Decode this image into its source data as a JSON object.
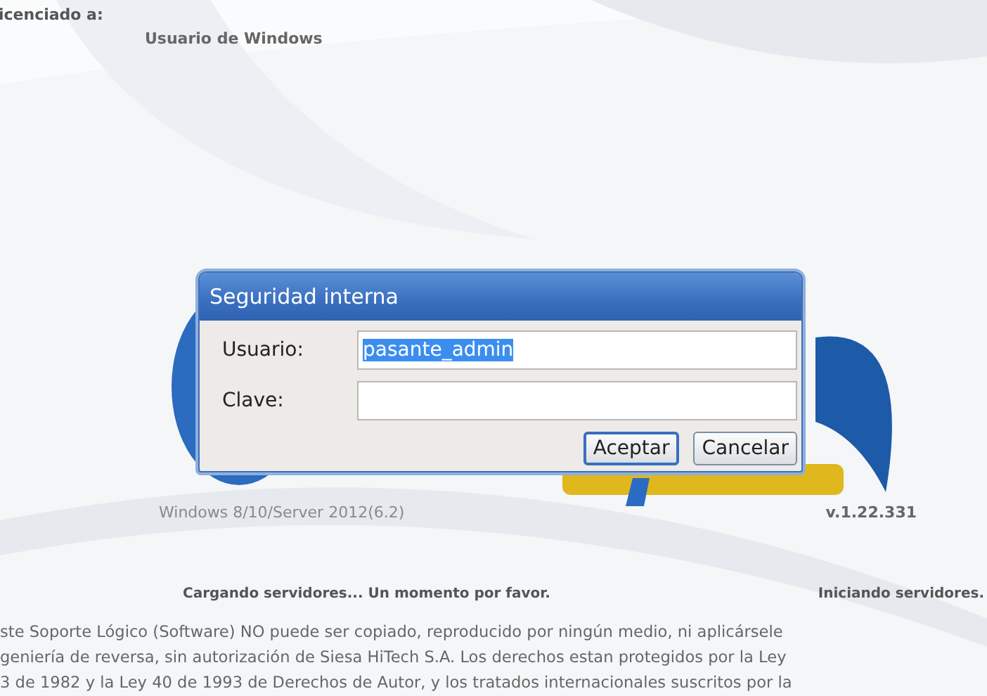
{
  "license": {
    "label": "icenciado a:",
    "user": "Usuario de Windows"
  },
  "system": {
    "os": "Windows 8/10/Server 2012(6.2)",
    "version": "v.1.22.331"
  },
  "status": {
    "left": "Cargando servidores... Un momento por favor.",
    "right": "Iniciando servidores."
  },
  "legal": [
    "ste Soporte Lógico (Software) NO puede ser copiado, reproducido por ningún medio, ni aplicársele",
    "geniería de reversa, sin autorización de Siesa HiTech S.A. Los derechos estan protegidos por la Ley",
    "3 de 1982 y la Ley 40 de 1993 de Derechos de Autor, y los tratados internacionales suscritos por la"
  ],
  "dialog": {
    "title": "Seguridad interna",
    "fields": [
      {
        "label": "Usuario:",
        "value": "pasante_admin",
        "highlighted": true
      },
      {
        "label": "Clave:"
      }
    ],
    "buttons": [
      {
        "label": "Aceptar",
        "default": true
      },
      {
        "label": "Cancelar",
        "default": false
      }
    ]
  }
}
